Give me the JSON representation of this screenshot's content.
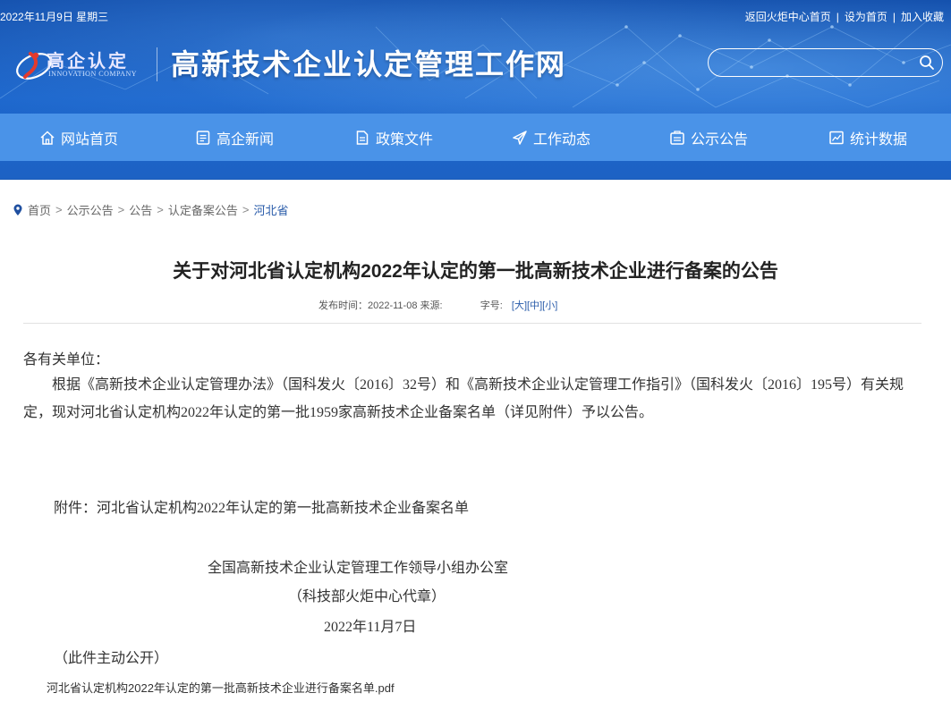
{
  "header": {
    "date": "2022年11月9日 星期三",
    "top_links": [
      "返回火炬中心首页",
      "设为首页",
      "加入收藏"
    ],
    "top_link_separator": "|",
    "logo_cn": "高企认定",
    "logo_en": "INNOVATION COMPANY",
    "site_title": "高新技术企业认定管理工作网",
    "search": {
      "value": "",
      "placeholder": ""
    }
  },
  "nav": {
    "items": [
      {
        "label": "网站首页",
        "icon": "home-icon"
      },
      {
        "label": "高企新闻",
        "icon": "news-icon"
      },
      {
        "label": "政策文件",
        "icon": "document-icon"
      },
      {
        "label": "工作动态",
        "icon": "send-icon"
      },
      {
        "label": "公示公告",
        "icon": "notice-icon"
      },
      {
        "label": "统计数据",
        "icon": "chart-icon"
      }
    ]
  },
  "breadcrumb": {
    "items": [
      "首页",
      "公示公告",
      "公告",
      "认定备案公告",
      "河北省"
    ],
    "separator": ">"
  },
  "article": {
    "title": "关于对河北省认定机构2022年认定的第一批高新技术企业进行备案的公告",
    "meta": {
      "publish_label": "发布时间：",
      "publish_date": "2022-11-08",
      "source_label": "来源:",
      "fontsize_label": "字号:",
      "sizes": [
        "[大]",
        "[中]",
        "[小]"
      ]
    },
    "salutation": "各有关单位：",
    "body": "根据《高新技术企业认定管理办法》（国科发火〔2016〕32号）和《高新技术企业认定管理工作指引》（国科发火〔2016〕195号）有关规定，现对河北省认定机构2022年认定的第一批1959家高新技术企业备案名单（详见附件）予以公告。",
    "attachment_line": "附件：河北省认定机构2022年认定的第一批高新技术企业备案名单",
    "issuer": "全国高新技术企业认定管理工作领导小组办公室",
    "seal": "（科技部火炬中心代章）",
    "sign_date": "2022年11月7日",
    "public_note": "（此件主动公开）",
    "pdf_link": "河北省认定机构2022年认定的第一批高新技术企业进行备案名单.pdf"
  }
}
